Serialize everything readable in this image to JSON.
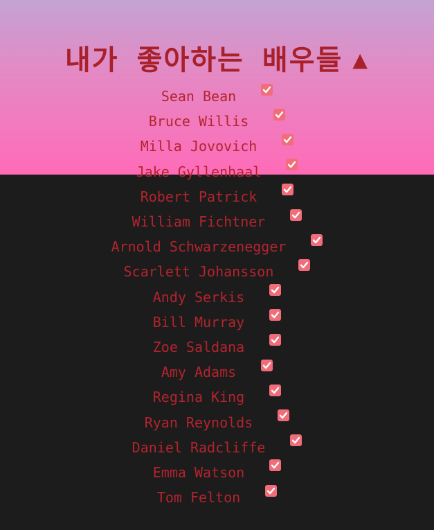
{
  "page": {
    "title": "내가 좋아하는 배우들",
    "title_icon": "triangle-up-icon",
    "title_icon_glyph": "▲"
  },
  "colors": {
    "text": "#b3242d",
    "checkbox": "#f26d7a",
    "background_dark": "#1c1c1c",
    "gradient_top": "#c4a3d4",
    "gradient_bottom": "#ff6bb8"
  },
  "actors": [
    {
      "name": "Sean Bean",
      "checked": true
    },
    {
      "name": "Bruce Willis",
      "checked": true
    },
    {
      "name": "Milla Jovovich",
      "checked": true
    },
    {
      "name": "Jake Gyllenhaal",
      "checked": true
    },
    {
      "name": "Robert Patrick",
      "checked": true
    },
    {
      "name": "William Fichtner",
      "checked": true
    },
    {
      "name": "Arnold Schwarzenegger",
      "checked": true
    },
    {
      "name": "Scarlett Johansson",
      "checked": true
    },
    {
      "name": "Andy Serkis",
      "checked": true
    },
    {
      "name": "Bill Murray",
      "checked": true
    },
    {
      "name": "Zoe Saldana",
      "checked": true
    },
    {
      "name": "Amy Adams",
      "checked": true
    },
    {
      "name": "Regina King",
      "checked": true
    },
    {
      "name": "Ryan Reynolds",
      "checked": true
    },
    {
      "name": "Daniel Radcliffe",
      "checked": true
    },
    {
      "name": "Emma Watson",
      "checked": true
    },
    {
      "name": "Tom Felton",
      "checked": true
    }
  ]
}
